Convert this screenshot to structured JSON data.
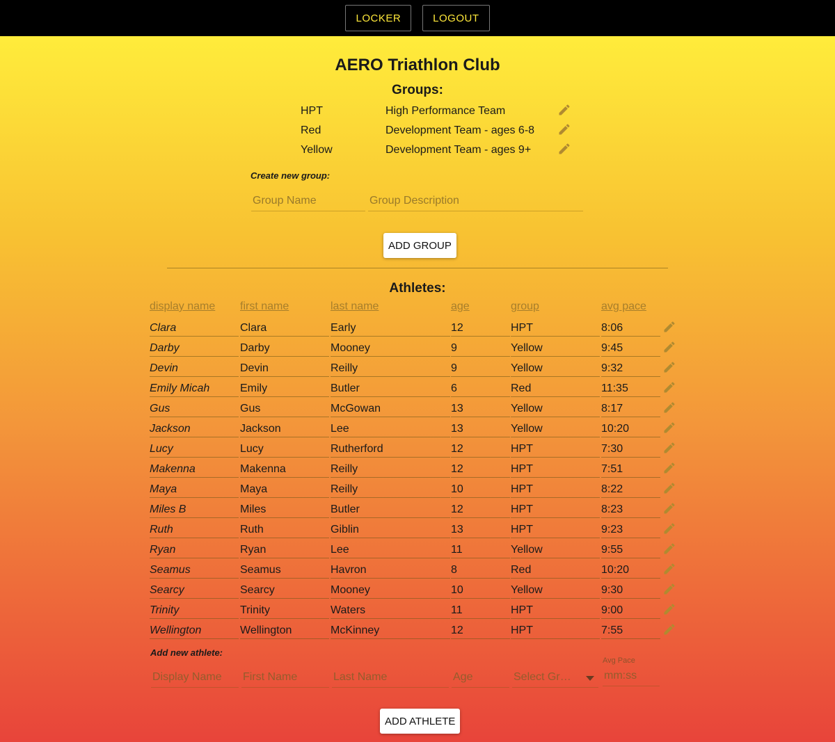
{
  "topbar": {
    "locker_label": "LOCKER",
    "logout_label": "LOGOUT"
  },
  "club_name": "AERO Triathlon Club",
  "groups_heading": "Groups:",
  "groups": [
    {
      "name": "HPT",
      "description": "High Performance Team"
    },
    {
      "name": "Red",
      "description": "Development Team - ages 6-8"
    },
    {
      "name": "Yellow",
      "description": "Development Team - ages 9+"
    }
  ],
  "create_group": {
    "label": "Create new group:",
    "name_placeholder": "Group Name",
    "description_placeholder": "Group Description",
    "button_label": "ADD GROUP"
  },
  "athletes_heading": "Athletes:",
  "athlete_columns": [
    "display name",
    "first name",
    "last name",
    "age",
    "group",
    "avg pace"
  ],
  "athletes": [
    {
      "display": "Clara",
      "first": "Clara",
      "last": "Early",
      "age": "12",
      "group": "HPT",
      "pace": "8:06"
    },
    {
      "display": "Darby",
      "first": "Darby",
      "last": "Mooney",
      "age": "9",
      "group": "Yellow",
      "pace": "9:45"
    },
    {
      "display": "Devin",
      "first": "Devin",
      "last": "Reilly",
      "age": "9",
      "group": "Yellow",
      "pace": "9:32"
    },
    {
      "display": "Emily Micah",
      "first": "Emily",
      "last": "Butler",
      "age": "6",
      "group": "Red",
      "pace": "11:35"
    },
    {
      "display": "Gus",
      "first": "Gus",
      "last": "McGowan",
      "age": "13",
      "group": "Yellow",
      "pace": "8:17"
    },
    {
      "display": "Jackson",
      "first": "Jackson",
      "last": "Lee",
      "age": "13",
      "group": "Yellow",
      "pace": "10:20"
    },
    {
      "display": "Lucy",
      "first": "Lucy",
      "last": "Rutherford",
      "age": "12",
      "group": "HPT",
      "pace": "7:30"
    },
    {
      "display": "Makenna",
      "first": "Makenna",
      "last": "Reilly",
      "age": "12",
      "group": "HPT",
      "pace": "7:51"
    },
    {
      "display": "Maya",
      "first": "Maya",
      "last": "Reilly",
      "age": "10",
      "group": "HPT",
      "pace": "8:22"
    },
    {
      "display": "Miles B",
      "first": "Miles",
      "last": "Butler",
      "age": "12",
      "group": "HPT",
      "pace": "8:23"
    },
    {
      "display": "Ruth",
      "first": "Ruth",
      "last": "Giblin",
      "age": "13",
      "group": "HPT",
      "pace": "9:23"
    },
    {
      "display": "Ryan",
      "first": "Ryan",
      "last": "Lee",
      "age": "11",
      "group": "Yellow",
      "pace": "9:55"
    },
    {
      "display": "Seamus",
      "first": "Seamus",
      "last": "Havron",
      "age": "8",
      "group": "Red",
      "pace": "10:20"
    },
    {
      "display": "Searcy",
      "first": "Searcy",
      "last": "Mooney",
      "age": "10",
      "group": "Yellow",
      "pace": "9:30"
    },
    {
      "display": "Trinity",
      "first": "Trinity",
      "last": "Waters",
      "age": "11",
      "group": "HPT",
      "pace": "9:00"
    },
    {
      "display": "Wellington",
      "first": "Wellington",
      "last": "McKinney",
      "age": "12",
      "group": "HPT",
      "pace": "7:55"
    }
  ],
  "add_athlete": {
    "label": "Add new athlete:",
    "display_placeholder": "Display Name",
    "first_placeholder": "First Name",
    "last_placeholder": "Last Name",
    "age_placeholder": "Age",
    "group_placeholder": "Select Gr…",
    "pace_label": "Avg Pace",
    "pace_placeholder": "mm:ss",
    "button_label": "ADD ATHLETE"
  },
  "icons": {
    "edit": "pencil-icon",
    "dropdown": "chevron-down-icon"
  },
  "colors": {
    "topbar_bg": "#000000",
    "topbar_text": "#ffe83a",
    "gradient_top": "#ffec3b",
    "gradient_bottom": "#e8443a",
    "icon": "#b08a30"
  }
}
